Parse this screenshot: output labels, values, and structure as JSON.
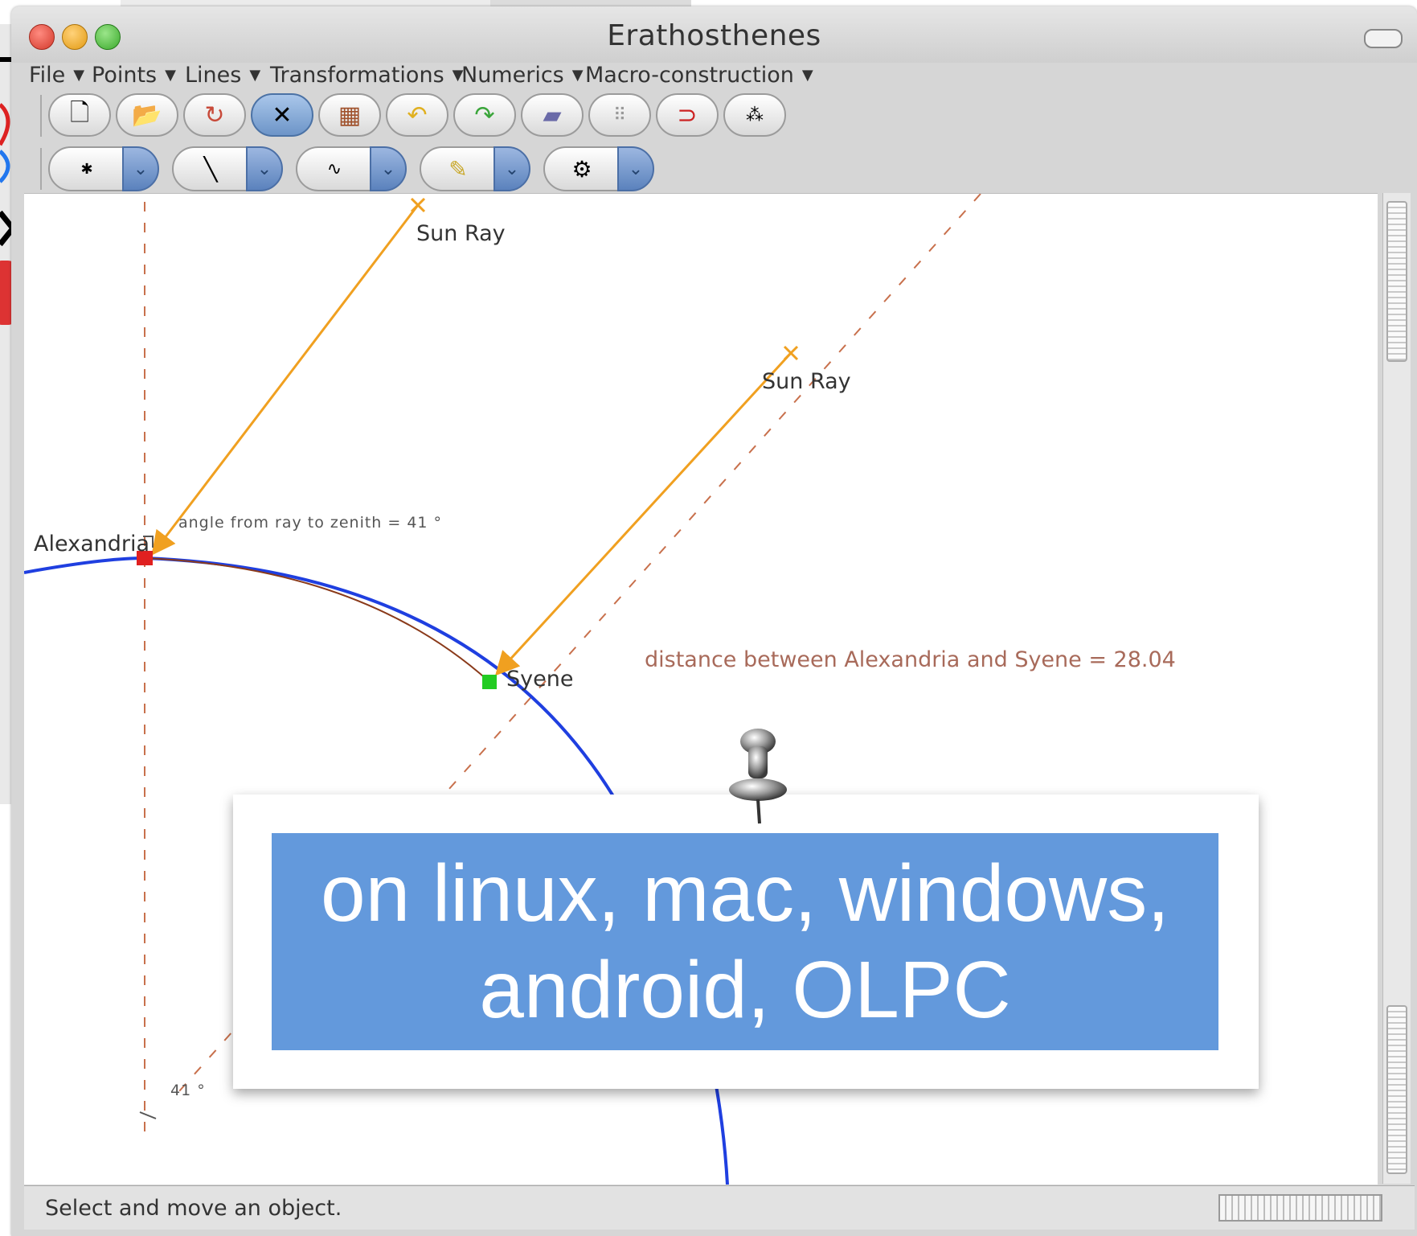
{
  "window": {
    "title": "Erathosthenes"
  },
  "menubar": {
    "items": [
      "File",
      "Points",
      "Lines",
      "Transformations",
      "Numerics",
      "Macro-construction"
    ]
  },
  "toolbar1": {
    "tools": [
      "new-file-icon",
      "open-file-icon",
      "save-file-icon",
      "select-move-icon",
      "palette-icon",
      "undo-icon",
      "redo-icon",
      "eraser-icon",
      "grid-icon",
      "magnet-icon",
      "points-icon"
    ],
    "active_tool": "select-move-icon"
  },
  "toolbar2": {
    "groups": [
      "point-tool-icon",
      "line-tool-icon",
      "curve-tool-icon",
      "measure-tool-icon",
      "animation-tool-icon"
    ]
  },
  "figure": {
    "labels": {
      "sun_ray_1": "Sun Ray",
      "sun_ray_2": "Sun Ray",
      "alexandria": "Alexandria",
      "syene": "Syene",
      "angle_text": "angle from ray to zenith = 41 °",
      "distance_text": "distance between Alexandria and Syene = 28.04",
      "angle_mark": "41 °"
    },
    "colors": {
      "sun_ray": "#f0a020",
      "circle": "#1f3fe0",
      "dashed": "#c8704c",
      "arc_highlight": "#8a3a1a",
      "alexandria_point": "#e02020",
      "syene_point": "#22cc22"
    }
  },
  "status": {
    "text": "Select and move an object."
  },
  "overlay": {
    "line1": "on linux, mac, windows,",
    "line2": "android, OLPC",
    "background": "#6399dc"
  }
}
